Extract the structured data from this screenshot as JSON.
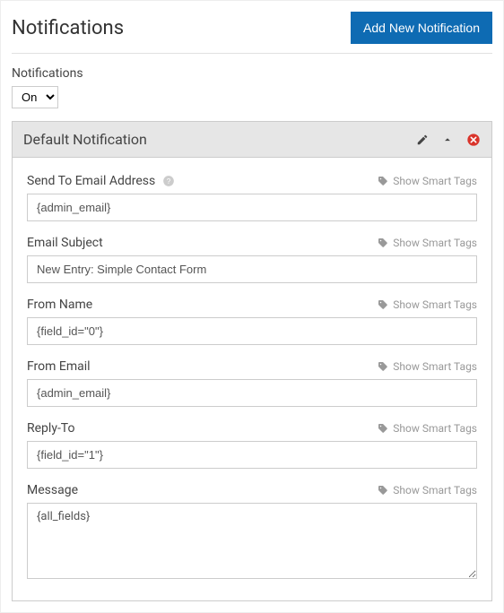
{
  "header": {
    "title": "Notifications",
    "add_button": "Add New Notification"
  },
  "toggle": {
    "label": "Notifications",
    "value": "On"
  },
  "panel": {
    "title": "Default Notification",
    "smart_tags_label": "Show Smart Tags",
    "fields": {
      "send_to": {
        "label": "Send To Email Address",
        "value": "{admin_email}"
      },
      "subject": {
        "label": "Email Subject",
        "value": "New Entry: Simple Contact Form"
      },
      "from_name": {
        "label": "From Name",
        "value": "{field_id=\"0\"}"
      },
      "from_email": {
        "label": "From Email",
        "value": "{admin_email}"
      },
      "reply_to": {
        "label": "Reply-To",
        "value": "{field_id=\"1\"}"
      },
      "message": {
        "label": "Message",
        "value": "{all_fields}"
      }
    }
  }
}
